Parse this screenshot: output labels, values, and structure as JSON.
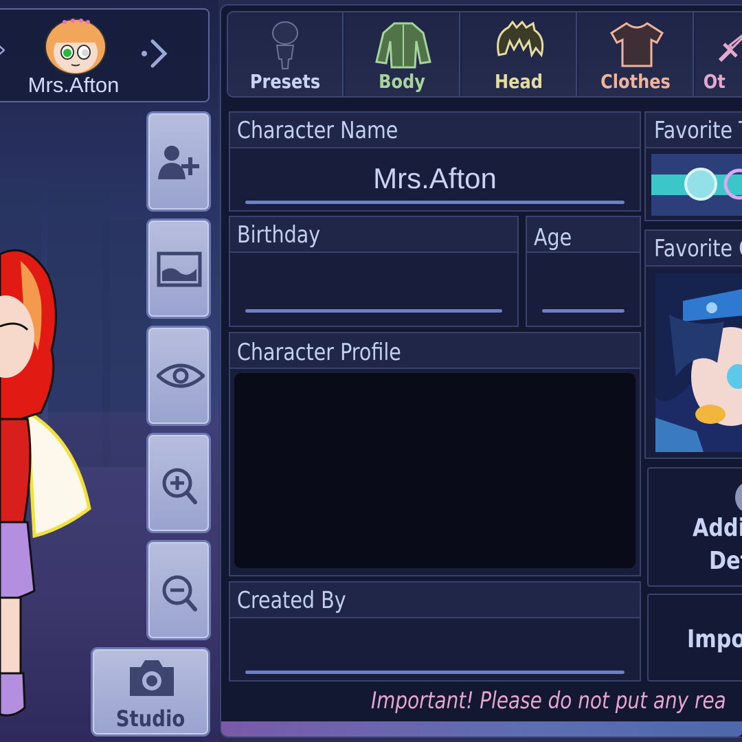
{
  "character": {
    "selector_name": "Mrs.Afton"
  },
  "side_buttons": [
    "add-character",
    "background",
    "visibility",
    "zoom-in",
    "zoom-out"
  ],
  "studio_label": "Studio",
  "tabs": [
    {
      "label": "Presets",
      "icon": "mannequin-icon",
      "color": "#c9d4f2"
    },
    {
      "label": "Body",
      "icon": "jacket-icon",
      "color": "#a6d59a"
    },
    {
      "label": "Head",
      "icon": "hair-icon",
      "color": "#e5dca0"
    },
    {
      "label": "Clothes",
      "icon": "shirt-icon",
      "color": "#f0b39c"
    },
    {
      "label": "Ot",
      "icon": "sword-icon",
      "color": "#e5a8cf"
    }
  ],
  "fields": {
    "character_name_label": "Character Name",
    "character_name_value": "Mrs.Afton",
    "birthday_label": "Birthday",
    "age_label": "Age",
    "profile_label": "Character Profile",
    "created_by_label": "Created By"
  },
  "right_column": {
    "favorite_t_label": "Favorite T",
    "favorite_c_label": "Favorite C",
    "additional_line1": "Addit",
    "additional_line2": "Det",
    "import_label": "Impo"
  },
  "warning_text": "Important! Please do not put any rea",
  "colors": {
    "panel": "#121732",
    "accent_underline": "#6e80bf",
    "warning": "#e7a5cf"
  }
}
